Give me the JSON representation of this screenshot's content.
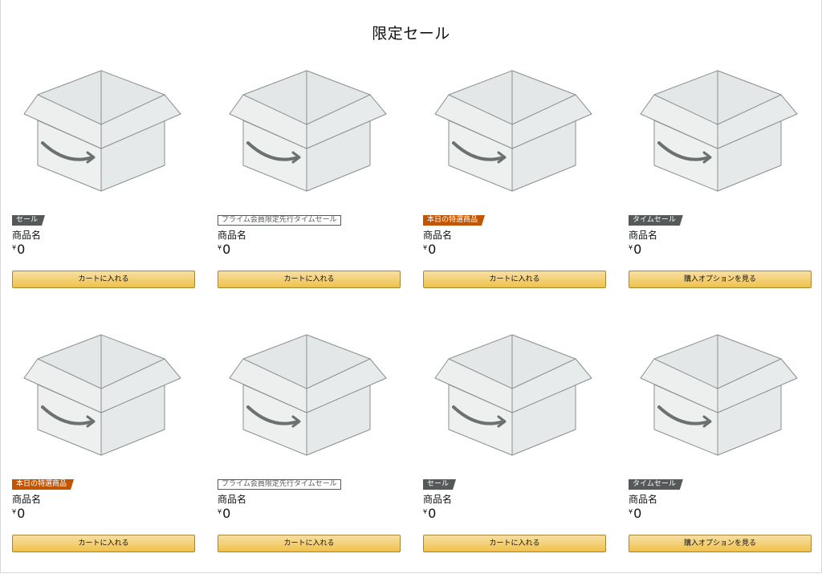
{
  "page": {
    "title": "限定セール"
  },
  "colors": {
    "badge_dark": "#565959",
    "badge_orange": "#c45500",
    "button_top": "#f7dfa5",
    "button_bottom": "#f0c14b",
    "button_border": "#a88734"
  },
  "products": [
    {
      "badge": "セール",
      "badge_style": "dark",
      "name": "商品名",
      "currency": "¥",
      "price": "0",
      "button": "カートに入れる",
      "image_icon": "amazon-box-icon"
    },
    {
      "badge": "プライム会員限定先行タイムセール",
      "badge_style": "outline",
      "name": "商品名",
      "currency": "¥",
      "price": "0",
      "button": "カートに入れる",
      "image_icon": "amazon-box-icon"
    },
    {
      "badge": "本日の特選商品",
      "badge_style": "orange",
      "name": "商品名",
      "currency": "¥",
      "price": "0",
      "button": "カートに入れる",
      "image_icon": "amazon-box-icon"
    },
    {
      "badge": "タイムセール",
      "badge_style": "dark",
      "name": "商品名",
      "currency": "¥",
      "price": "0",
      "button": "購入オプションを見る",
      "image_icon": "amazon-box-icon"
    },
    {
      "badge": "本日の特選商品",
      "badge_style": "orange",
      "name": "商品名",
      "currency": "¥",
      "price": "0",
      "button": "カートに入れる",
      "image_icon": "amazon-box-icon"
    },
    {
      "badge": "プライム会員限定先行タイムセール",
      "badge_style": "outline",
      "name": "商品名",
      "currency": "¥",
      "price": "0",
      "button": "カートに入れる",
      "image_icon": "amazon-box-icon"
    },
    {
      "badge": "セール",
      "badge_style": "dark",
      "name": "商品名",
      "currency": "¥",
      "price": "0",
      "button": "カートに入れる",
      "image_icon": "amazon-box-icon"
    },
    {
      "badge": "タイムセール",
      "badge_style": "dark",
      "name": "商品名",
      "currency": "¥",
      "price": "0",
      "button": "購入オプションを見る",
      "image_icon": "amazon-box-icon"
    }
  ]
}
